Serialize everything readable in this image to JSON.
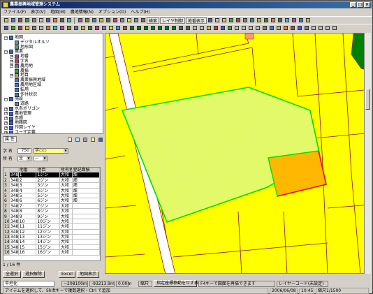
{
  "app": {
    "title": "農業振興地域管理システム"
  },
  "menu": [
    "ファイル(F)",
    "表示(V)",
    "地図(M)",
    "農地情報(N)",
    "オプション(O)",
    "ヘルプ(H)"
  ],
  "toolbar1": {
    "text1": "検索",
    "text2": "レイヤ制御",
    "text3": "地番表示"
  },
  "tree": {
    "nodes": [
      {
        "label": "地図",
        "level": 0,
        "expand": "−",
        "color": "#4060c0"
      },
      {
        "label": "デジタルオルソ",
        "level": 1,
        "expand": "",
        "color": "#60a060"
      },
      {
        "label": "地形図",
        "level": 1,
        "expand": "",
        "color": "#60a060"
      },
      {
        "label": "農業",
        "level": 0,
        "expand": "−",
        "color": "#4060c0"
      },
      {
        "label": "地番",
        "level": 1,
        "expand": "+",
        "color": "#c04040"
      },
      {
        "label": "字名",
        "level": 1,
        "expand": "+",
        "color": "#c04040"
      },
      {
        "label": "農用地",
        "level": 1,
        "expand": "+",
        "color": "#40a040"
      },
      {
        "label": "農振",
        "level": 1,
        "expand": "",
        "color": "#40a040"
      },
      {
        "label": "地目",
        "level": 1,
        "expand": "+",
        "color": "#c0a040"
      },
      {
        "label": "農業振興地域",
        "level": 1,
        "expand": "",
        "color": "#4080c0"
      },
      {
        "label": "農用地区域",
        "level": 1,
        "expand": "",
        "color": "#4080c0"
      },
      {
        "label": "転用",
        "level": 1,
        "expand": "",
        "color": "#4080c0"
      },
      {
        "label": "作付状況",
        "level": 1,
        "expand": "",
        "color": "#4080c0"
      },
      {
        "label": "施設",
        "level": 0,
        "expand": "−",
        "color": "#4060c0"
      },
      {
        "label": "道路",
        "level": 1,
        "expand": "",
        "color": "#808080"
      },
      {
        "label": "水系ポリゴン",
        "level": 0,
        "expand": "+",
        "color": "#4060c0"
      },
      {
        "label": "農地管理",
        "level": 0,
        "expand": "+",
        "color": "#4060c0"
      },
      {
        "label": "参照",
        "level": 0,
        "expand": "+",
        "color": "#4060c0"
      },
      {
        "label": "地籍図",
        "level": 0,
        "expand": "+",
        "color": "#4060c0"
      },
      {
        "label": "作図レイヤ",
        "level": 0,
        "expand": "+",
        "color": "#4060c0"
      },
      {
        "label": "ユーザ定義",
        "level": 0,
        "expand": "+",
        "color": "#4060c0"
      }
    ]
  },
  "treebar": {
    "tab_label": "属 性"
  },
  "panel": {
    "row1_label": "字 名",
    "row1_code": "750",
    "row1_value": "字○○",
    "row2_label": "所 有",
    "row2_value": "全",
    "row2_value2": "−"
  },
  "grid": {
    "headers": [
      "",
      "",
      "地番",
      "地目",
      "所有者",
      "登記面積"
    ],
    "rows": [
      [
        "1",
        "348",
        "1",
        "1ジン",
        "大和",
        "畑"
      ],
      [
        "2",
        "348",
        "2",
        "2ジン",
        "大和",
        "畑"
      ],
      [
        "3",
        "348",
        "3",
        "3ジン",
        "大和",
        "畑"
      ],
      [
        "4",
        "348",
        "4",
        "4ジン",
        "大和",
        "畑"
      ],
      [
        "5",
        "348",
        "5",
        "5ジン",
        "大和",
        "畑"
      ],
      [
        "6",
        "348",
        "6",
        "6ジン",
        "大和",
        "畑"
      ],
      [
        "7",
        "348",
        "7",
        "7ジン",
        "大和",
        ""
      ],
      [
        "8",
        "348",
        "8",
        "8ジン",
        "大和",
        ""
      ],
      [
        "9",
        "348",
        "9",
        "9ジン",
        "大和",
        ""
      ],
      [
        "10",
        "348",
        "10",
        "10ジン",
        "大和",
        ""
      ],
      [
        "11",
        "348",
        "11",
        "11ジン",
        "大和",
        ""
      ],
      [
        "12",
        "348",
        "12",
        "12ジン",
        "大和",
        ""
      ],
      [
        "13",
        "348",
        "13",
        "13ジン",
        "大和",
        ""
      ],
      [
        "14",
        "348",
        "14",
        "14ジン",
        "大和",
        ""
      ],
      [
        "15",
        "348",
        "15",
        "15ジン",
        "大和",
        ""
      ],
      [
        "16",
        "348",
        "16",
        "16ジン",
        "大和",
        ""
      ]
    ],
    "selected_index": 0
  },
  "pager": {
    "text": "1 / 16 件"
  },
  "panel_buttons": [
    "全選択",
    "選択解除",
    "Excel",
    "地図表示"
  ],
  "status": {
    "field1": "平坦化",
    "field2": "−208100m",
    "field3": "-93213.9m",
    "field4": "0.00m",
    "field5": "縮尺",
    "field6": "指定座標移動をせず表示",
    "field7": "F4キーで図面を再描できます",
    "field8": "レイヤーコード(未設定)"
  },
  "status_bottom": {
    "left": "アイテムを選択して、Shiftキーで複数選択・Ctrl で追加",
    "date": "2006/06/08",
    "time": "10:45",
    "right": "縮尺1/1500"
  },
  "map": {
    "colors": {
      "base": "#ffff00",
      "parcel_outline": "#8b1a1a",
      "highlight_outline": "#00e000",
      "road": "#ffffff",
      "sub_outline": "#ff0000",
      "sub_fill": "#ff9900",
      "forest": "#008000",
      "building": "#ff9966"
    }
  }
}
